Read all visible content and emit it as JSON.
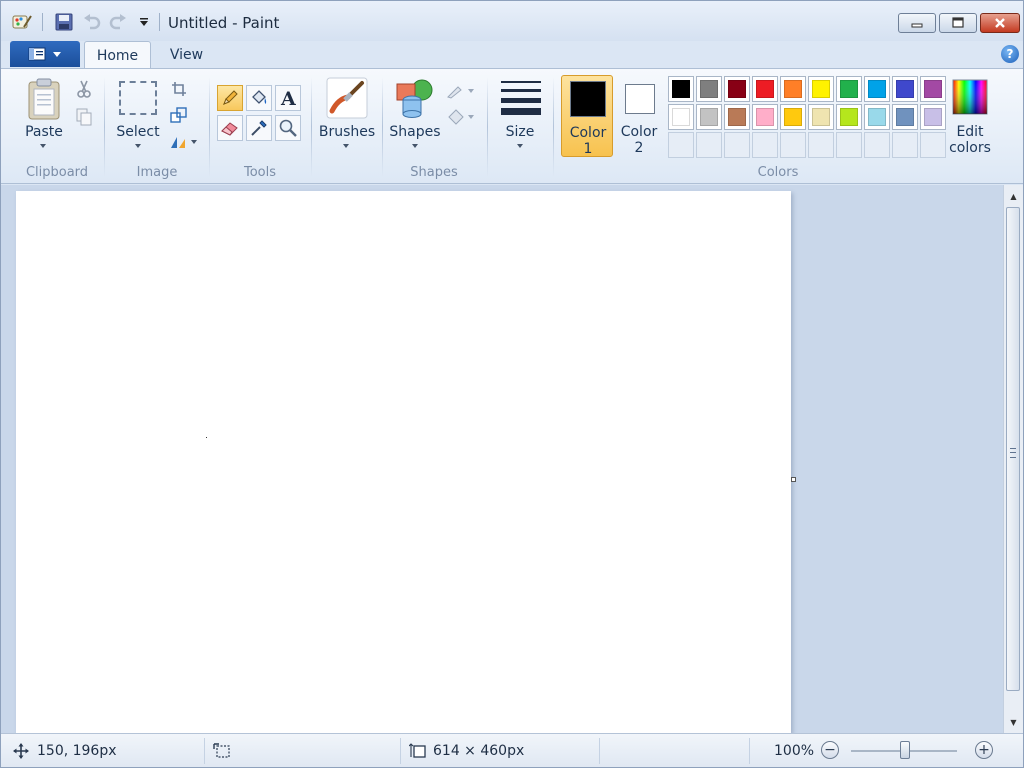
{
  "window": {
    "title": "Untitled - Paint"
  },
  "tabs": [
    {
      "label": "Home",
      "active": true
    },
    {
      "label": "View",
      "active": false
    }
  ],
  "ribbon": {
    "groups": {
      "clipboard": {
        "label": "Clipboard",
        "paste_label": "Paste"
      },
      "image": {
        "label": "Image",
        "select_label": "Select"
      },
      "tools": {
        "label": "Tools",
        "active_tool": "pencil-icon"
      },
      "brushes": {
        "label": "Brushes"
      },
      "shapes": {
        "label": "Shapes"
      },
      "size": {
        "label": "Size"
      },
      "colors": {
        "label": "Colors",
        "color1": {
          "line1": "Color",
          "line2": "1",
          "value": "#000000"
        },
        "color2": {
          "line1": "Color",
          "line2": "2",
          "value": "#ffffff"
        },
        "edit_line1": "Edit",
        "edit_line2": "colors",
        "palette_row1": [
          "#000000",
          "#7f7f7f",
          "#880015",
          "#ed1c24",
          "#ff7f27",
          "#fff200",
          "#22b14c",
          "#00a2e8",
          "#3f48cc",
          "#a349a4"
        ],
        "palette_row2": [
          "#ffffff",
          "#c3c3c3",
          "#b97a57",
          "#ffaec9",
          "#ffc90e",
          "#efe4b0",
          "#b5e61d",
          "#99d9ea",
          "#7092be",
          "#c8bfe7"
        ],
        "custom_slots": 10
      }
    }
  },
  "status": {
    "cursor_position": "150, 196px",
    "canvas_size": "614 × 460px",
    "zoom": "100%"
  }
}
